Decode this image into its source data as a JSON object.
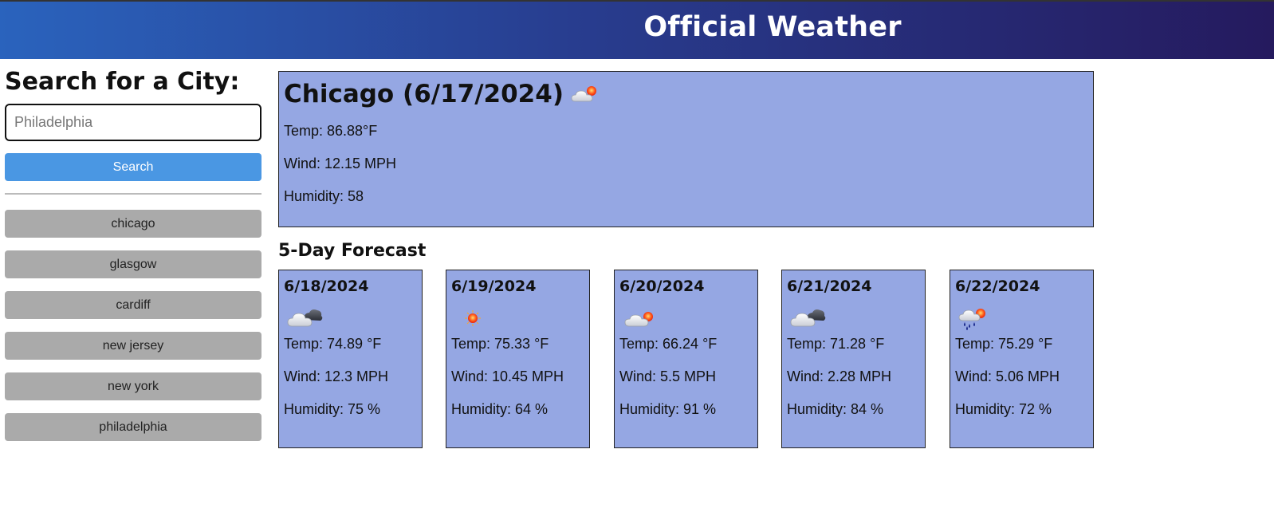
{
  "header": {
    "title": "Official Weather"
  },
  "sidebar": {
    "heading": "Search for a City:",
    "search_placeholder": "Philadelphia",
    "search_button": "Search",
    "history": [
      "chicago",
      "glasgow",
      "cardiff",
      "new jersey",
      "new york",
      "philadelphia"
    ]
  },
  "current": {
    "title": "Chicago (6/17/2024)",
    "icon": "sun-behind-cloud-icon",
    "temp": "Temp: 86.88°F",
    "wind": "Wind: 12.15 MPH",
    "humidity": "Humidity: 58"
  },
  "forecast": {
    "title": "5-Day Forecast",
    "days": [
      {
        "date": "6/18/2024",
        "icon": "cloudy-icon",
        "temp": "Temp: 74.89 °F",
        "wind": "Wind: 12.3 MPH",
        "humidity": "Humidity: 75 %"
      },
      {
        "date": "6/19/2024",
        "icon": "sun-icon",
        "temp": "Temp: 75.33 °F",
        "wind": "Wind: 10.45 MPH",
        "humidity": "Humidity: 64 %"
      },
      {
        "date": "6/20/2024",
        "icon": "sun-behind-cloud-icon",
        "temp": "Temp: 66.24 °F",
        "wind": "Wind: 5.5 MPH",
        "humidity": "Humidity: 91 %"
      },
      {
        "date": "6/21/2024",
        "icon": "cloudy-icon",
        "temp": "Temp: 71.28 °F",
        "wind": "Wind: 2.28 MPH",
        "humidity": "Humidity: 84 %"
      },
      {
        "date": "6/22/2024",
        "icon": "rain-icon",
        "temp": "Temp: 75.29 °F",
        "wind": "Wind: 5.06 MPH",
        "humidity": "Humidity: 72 %"
      }
    ]
  }
}
